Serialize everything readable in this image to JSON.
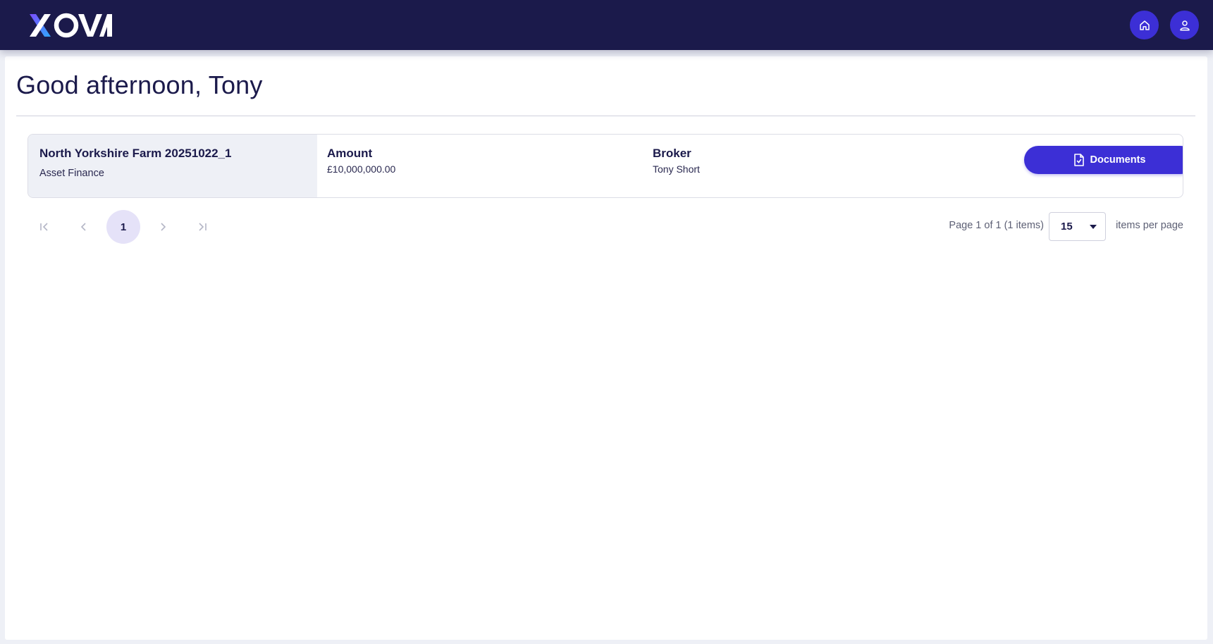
{
  "app": {
    "brand": "XOVA",
    "colors": {
      "navy": "#1b1a4b",
      "accent": "#3c2fd6",
      "logo_gradient": [
        "#7b4dff",
        "#2fa8ff"
      ]
    }
  },
  "topbar": {
    "home_icon": "home-icon",
    "profile_icon": "user-icon"
  },
  "main": {
    "greeting": "Good afternoon, Tony",
    "deals": [
      {
        "name": "North Yorkshire Farm 20251022_1",
        "type": "Asset Finance",
        "amount_label": "Amount",
        "amount_value": "£10,000,000.00",
        "broker_label": "Broker",
        "broker_value": "Tony Short",
        "documents_label": "Documents",
        "documents_icon": "document-icon"
      }
    ]
  },
  "pagination": {
    "first_icon": "first-page-icon",
    "prev_icon": "chevron-left-icon",
    "current_page": "1",
    "next_icon": "chevron-right-icon",
    "last_icon": "last-page-icon",
    "page_info": "Page 1 of 1 (1 items)",
    "per_page": "15",
    "per_page_label": "items per page"
  }
}
